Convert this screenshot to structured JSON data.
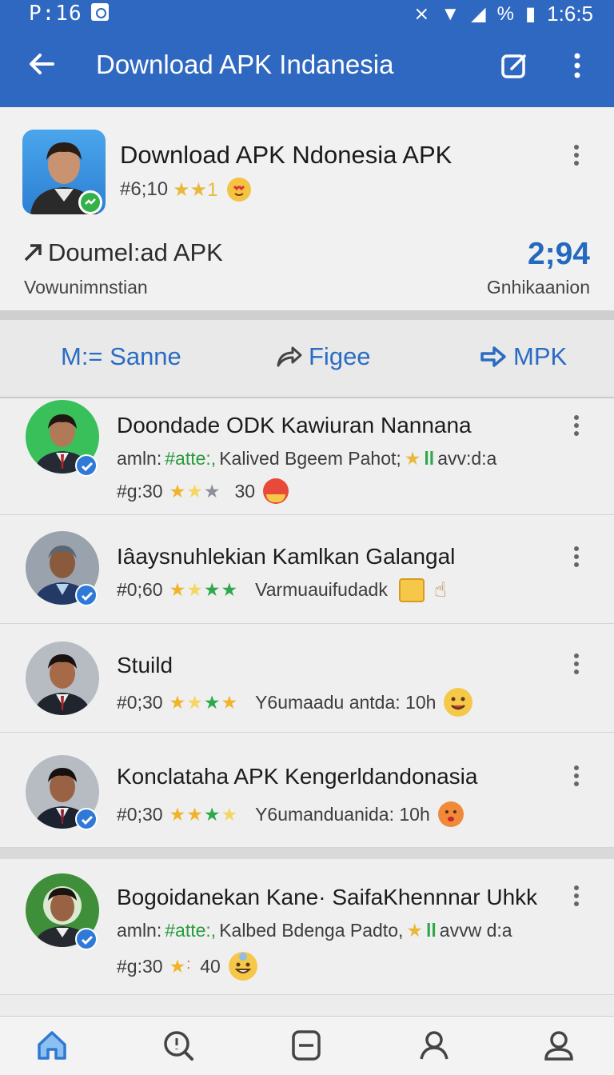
{
  "status": {
    "time": "P:16",
    "right_time": "1:6:5",
    "percent": "%"
  },
  "appbar": {
    "title": "Download APK Indanesia"
  },
  "hero": {
    "title": "Download APK Ndonesia APK",
    "rank": "#6;10",
    "rating_text": "★★1",
    "row_label": "Doumel:ad APK",
    "row_sub": "Vowunimnstian",
    "count": "2;94",
    "count_sub": "Gnhikaanion"
  },
  "actions": [
    {
      "label": "M:= Sanne",
      "icon": "list-icon"
    },
    {
      "label": "Figee",
      "icon": "share-icon"
    },
    {
      "label": "MPK",
      "icon": "forward-icon"
    }
  ],
  "items": [
    {
      "title": "Doondade ODK Kawiuran Nannana",
      "line1_prefix": "amln:",
      "line1_tag": "#atte:,",
      "line1_rest": "Kalived Bgeem Pahot;",
      "line1_suffix": "avv:d:a",
      "line2_rank": "#g:30",
      "line2_extra": "30",
      "avatar_bg": "#39c05a",
      "stars": [
        "#f2b32a",
        "#f5d660",
        "#8a8f99"
      ],
      "emoji": "#e84a3a"
    },
    {
      "title": "Iâaysnuhlekian Kamlkan Galangal",
      "line2_rank": "#0;60",
      "line2_extra": "Varmuauifudadk",
      "avatar_bg": "#9aa3ad",
      "stars": [
        "#f2b32a",
        "#f5d660",
        "#2fa84a",
        "#2fa84a"
      ],
      "emoji": "#f6c84a"
    },
    {
      "title": "Stuild",
      "line2_rank": "#0;30",
      "line2_extra": "Y6umaadu antda: 10h",
      "avatar_bg": "#b7bcc2",
      "stars": [
        "#f2b32a",
        "#f5d660",
        "#2fa84a",
        "#f2b32a"
      ],
      "emoji": "#f6c84a"
    },
    {
      "title": "Konclataha  APK Kengerldandonasia",
      "line2_rank": "#0;30",
      "line2_extra": "Y6umanduanida: 10h",
      "avatar_bg": "#b7bcc2",
      "stars": [
        "#f2b32a",
        "#f2b32a",
        "#2fa84a",
        "#f5d660"
      ],
      "emoji": "#f08a3a"
    },
    {
      "title": "Bogoidanekan Kane· SaifaKhennnar Uhkk",
      "line1_prefix": "amln:",
      "line1_tag": "#atte:,",
      "line1_rest": "Kalbed Bdenga Padto,",
      "line1_suffix": "avvw d:a",
      "line2_rank": "#g:30",
      "line2_extra": "40",
      "avatar_bg": "#3f8f3a",
      "stars": [
        "#f2b32a",
        "#e84a3a"
      ],
      "emoji": "#f6c84a"
    }
  ],
  "bottomnav": [
    {
      "label": "home",
      "icon": "home-icon"
    },
    {
      "label": "search",
      "icon": "search-icon"
    },
    {
      "label": "minus",
      "icon": "minus-box-icon"
    },
    {
      "label": "profile",
      "icon": "profile-icon"
    },
    {
      "label": "account",
      "icon": "account-icon"
    }
  ],
  "colors": {
    "primary": "#2f68c0",
    "accent": "#2a6cc4",
    "tag_green": "#2a9c3d"
  }
}
